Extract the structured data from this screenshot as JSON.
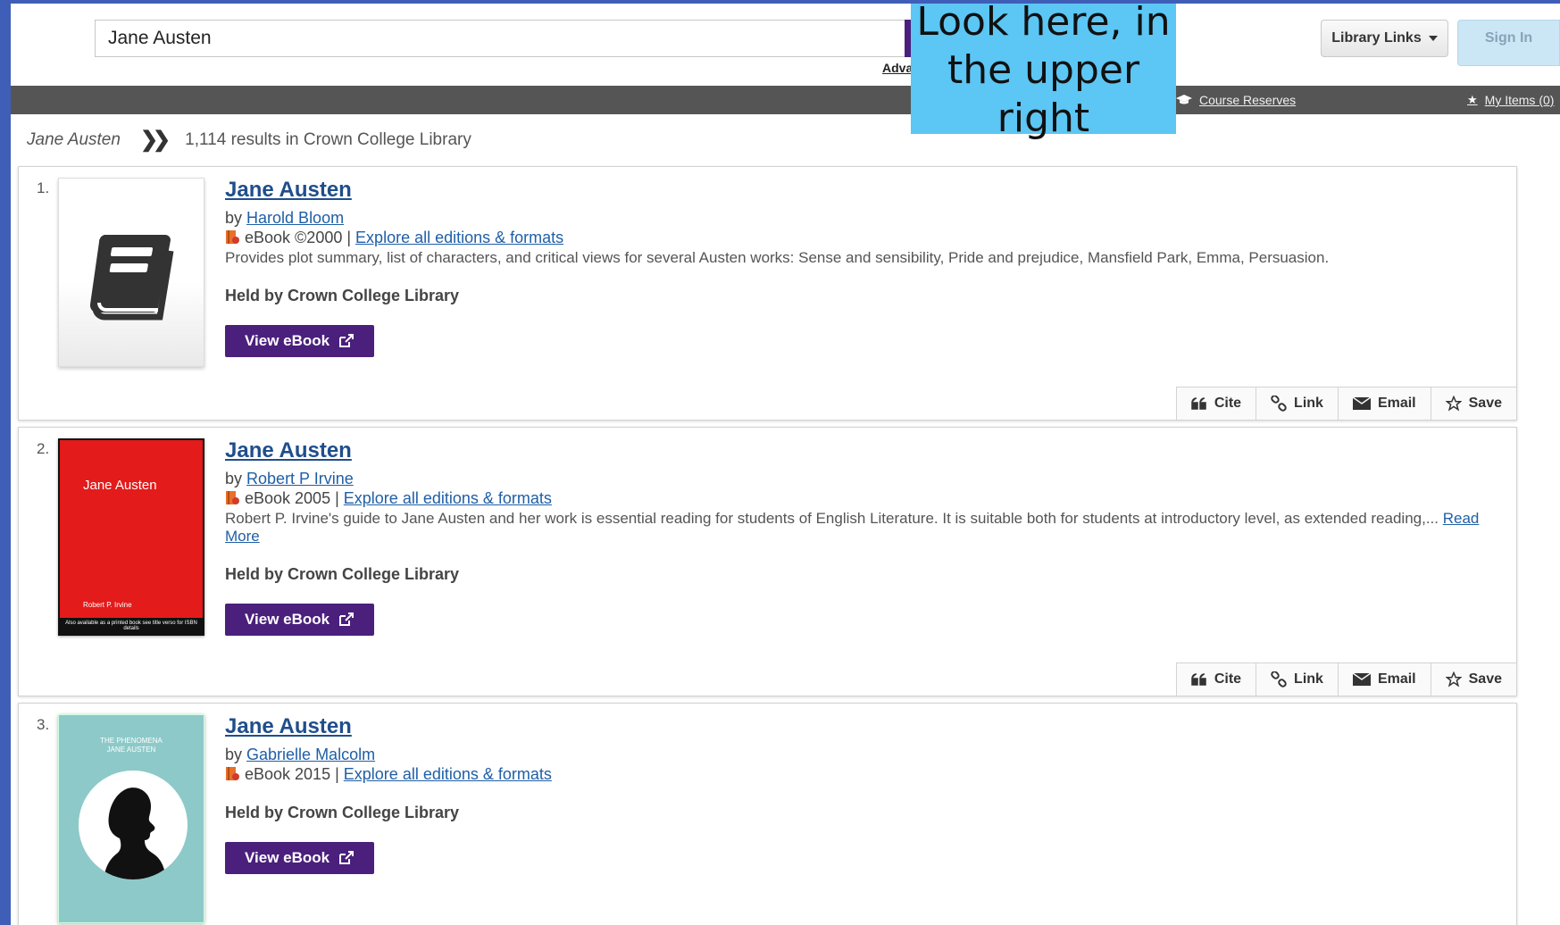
{
  "header": {
    "search_value": "Jane Austen",
    "advanced_label": "Advan",
    "library_links_label": "Library Links",
    "sign_in_label": "Sign In"
  },
  "callout": {
    "line1": "Look here, in",
    "line2": "the upper right"
  },
  "navbar": {
    "course_reserves": "Course Reserves",
    "my_items": "My Items (0)"
  },
  "breadcrumb": {
    "query": "Jane Austen",
    "results": "1,114 results in Crown College Library"
  },
  "actions": {
    "cite": "Cite",
    "link": "Link",
    "email": "Email",
    "save": "Save"
  },
  "results": [
    {
      "number": "1.",
      "title": "Jane Austen",
      "by": "by",
      "author": "Harold Bloom",
      "format": "eBook ©2000 |",
      "editions_link": "Explore all editions & formats",
      "description": "Provides plot summary, list of characters, and critical views for several Austen works: Sense and sensibility, Pride and prejudice, Mansfield Park, Emma, Persuasion.",
      "held": "Held by Crown College Library",
      "view_label": "View eBook"
    },
    {
      "number": "2.",
      "title": "Jane Austen",
      "by": "by",
      "author": "Robert P Irvine",
      "format": "eBook 2005 |",
      "editions_link": "Explore all editions & formats",
      "description": "Robert P. Irvine's guide to Jane Austen and her work is essential reading for students of English Literature. It is suitable both for students at introductory level, as extended reading,...",
      "read_more": "Read More",
      "held": "Held by Crown College Library",
      "view_label": "View eBook",
      "cover_title": "Jane Austen",
      "cover_author": "Robert P. Irvine",
      "cover_note": "Also available as a printed book see title verso for ISBN details"
    },
    {
      "number": "3.",
      "title": "Jane Austen",
      "by": "by",
      "author": "Gabrielle Malcolm",
      "format": "eBook 2015 |",
      "editions_link": "Explore all editions & formats",
      "held": "Held by Crown College Library",
      "view_label": "View eBook",
      "cover_series": "THE PHENOMENA",
      "cover_title": "JANE AUSTEN"
    }
  ],
  "colors": {
    "accent_purple": "#4b1f7c",
    "link_blue": "#1f5fa6",
    "callout": "#5cc6f4",
    "navbar": "#555555",
    "frame_blue": "#3f5eb8"
  }
}
